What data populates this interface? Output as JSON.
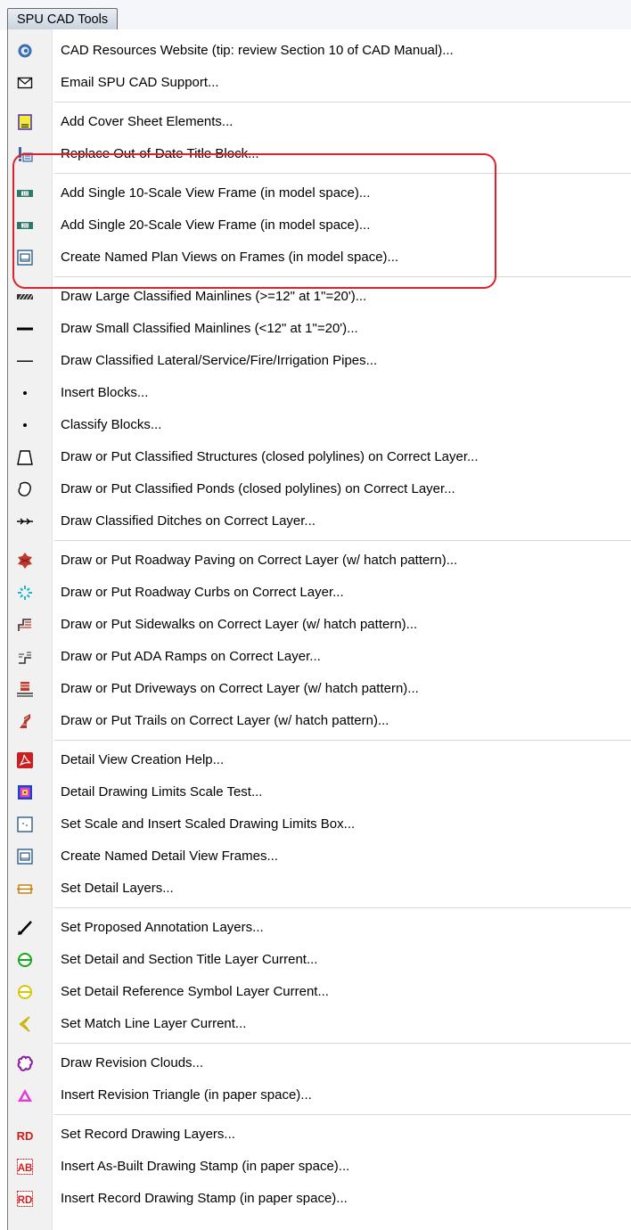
{
  "menu": {
    "title": "SPU CAD Tools",
    "groups": [
      {
        "items": [
          {
            "label": "CAD Resources Website (tip: review Section 10 of CAD Manual)...",
            "icon": "globe-icon"
          },
          {
            "label": "Email SPU CAD Support...",
            "icon": "envelope-icon"
          }
        ]
      },
      {
        "items": [
          {
            "label": "Add Cover Sheet Elements...",
            "icon": "cover-sheet-icon"
          },
          {
            "label": "Replace Out-of-Date Title Block...",
            "icon": "title-block-icon"
          }
        ]
      },
      {
        "items": [
          {
            "label": "Add Single 10-Scale View Frame (in model space)...",
            "icon": "scale-10-frame-icon",
            "icon_text": "10"
          },
          {
            "label": "Add Single 20-Scale View Frame (in model space)...",
            "icon": "scale-20-frame-icon",
            "icon_text": "20"
          },
          {
            "label": "Create Named Plan Views on Frames (in model space)...",
            "icon": "named-view-frame-icon"
          }
        ]
      },
      {
        "items": [
          {
            "label": "Draw Large Classified Mainlines (>=12\" at 1\"=20')...",
            "icon": "hatched-line-icon"
          },
          {
            "label": "Draw Small Classified Mainlines (<12\" at 1\"=20')...",
            "icon": "thick-line-icon"
          },
          {
            "label": "Draw Classified Lateral/Service/Fire/Irrigation Pipes...",
            "icon": "thin-line-icon"
          },
          {
            "label": "Insert Blocks...",
            "icon": "dot-icon"
          },
          {
            "label": "Classify Blocks...",
            "icon": "dot-icon"
          },
          {
            "label": "Draw or Put Classified Structures (closed polylines) on Correct Layer...",
            "icon": "closed-polyline-icon"
          },
          {
            "label": "Draw or Put Classified Ponds (closed polylines) on Correct Layer...",
            "icon": "pond-outline-icon"
          },
          {
            "label": "Draw Classified Ditches on Correct Layer...",
            "icon": "ditch-arrows-icon"
          }
        ]
      },
      {
        "items": [
          {
            "label": "Draw or Put Roadway Paving on Correct Layer (w/ hatch pattern)...",
            "icon": "paving-icon"
          },
          {
            "label": "Draw or Put Roadway Curbs on Correct Layer...",
            "icon": "curbs-icon"
          },
          {
            "label": "Draw or Put Sidewalks on Correct Layer (w/ hatch pattern)...",
            "icon": "sidewalk-icon"
          },
          {
            "label": "Draw or Put ADA Ramps on Correct Layer...",
            "icon": "ada-ramp-icon"
          },
          {
            "label": "Draw or Put Driveways on Correct Layer (w/ hatch pattern)...",
            "icon": "driveway-icon"
          },
          {
            "label": "Draw or Put Trails on Correct Layer (w/ hatch pattern)...",
            "icon": "trail-icon"
          }
        ]
      },
      {
        "items": [
          {
            "label": "Detail View Creation Help...",
            "icon": "pdf-icon"
          },
          {
            "label": "Detail Drawing Limits Scale Test...",
            "icon": "limits-test-icon"
          },
          {
            "label": "Set Scale and Insert Scaled Drawing Limits Box...",
            "icon": "limits-box-icon"
          },
          {
            "label": "Create Named Detail View Frames...",
            "icon": "named-view-frame-icon"
          },
          {
            "label": "Set Detail Layers...",
            "icon": "detail-layers-icon"
          }
        ]
      },
      {
        "items": [
          {
            "label": "Set Proposed Annotation Layers...",
            "icon": "annotation-leader-icon"
          },
          {
            "label": "Set Detail and Section Title Layer Current...",
            "icon": "section-title-icon"
          },
          {
            "label": "Set Detail Reference Symbol Layer Current...",
            "icon": "reference-symbol-icon"
          },
          {
            "label": "Set Match Line Layer Current...",
            "icon": "match-line-icon"
          }
        ]
      },
      {
        "items": [
          {
            "label": "Draw Revision Clouds...",
            "icon": "revision-cloud-icon"
          },
          {
            "label": "Insert Revision Triangle (in paper space)...",
            "icon": "revision-triangle-icon"
          }
        ]
      },
      {
        "items": [
          {
            "label": "Set Record Drawing Layers...",
            "icon": "rd-icon",
            "icon_text": "RD"
          },
          {
            "label": "Insert As-Built Drawing Stamp (in paper space)...",
            "icon": "ab-stamp-icon",
            "icon_text": "AB"
          },
          {
            "label": "Insert Record Drawing Stamp (in paper space)...",
            "icon": "rd-stamp-icon",
            "icon_text": "RD"
          }
        ]
      }
    ]
  },
  "colors": {
    "highlight": "#e0202a",
    "gutter": "#f1f1f1",
    "separator": "#d7d7d7"
  }
}
